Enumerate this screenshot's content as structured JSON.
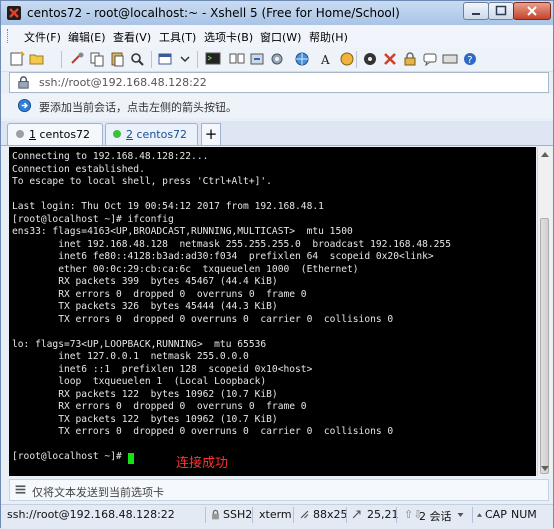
{
  "window": {
    "title": "centos72 - root@localhost:~ - Xshell 5 (Free for Home/School)"
  },
  "menu": {
    "items": [
      "文件(F)",
      "编辑(E)",
      "查看(V)",
      "工具(T)",
      "选项卡(B)",
      "窗口(W)",
      "帮助(H)"
    ]
  },
  "toolbar": {
    "icons": [
      "new-session-icon",
      "open-folder-icon",
      "link-icon",
      "copy-icon",
      "paste-icon",
      "find-icon",
      "properties-icon",
      "terminal-icon",
      "transfer-icon",
      "globe-icon",
      "font-icon",
      "color-icon",
      "keyboard-icon",
      "script-icon",
      "xftp-icon",
      "chat-icon",
      "lock-icon",
      "help-icon"
    ]
  },
  "address": {
    "value": "ssh://root@192.168.48.128:22"
  },
  "info": {
    "text": "要添加当前会话，点击左侧的箭头按钮。"
  },
  "tabs": [
    {
      "num": "1",
      "name": "centos72",
      "active": false,
      "dot_color": "#9aa0a8"
    },
    {
      "num": "2",
      "name": "centos72",
      "active": true,
      "dot_color": "#3cbf3c"
    }
  ],
  "tab_add_label": "+",
  "terminal": {
    "lines": [
      "Connecting to 192.168.48.128:22...",
      "Connection established.",
      "To escape to local shell, press 'Ctrl+Alt+]'.",
      "",
      "Last login: Thu Oct 19 00:54:12 2017 from 192.168.48.1",
      "[root@localhost ~]# ifconfig",
      "ens33: flags=4163<UP,BROADCAST,RUNNING,MULTICAST>  mtu 1500",
      "        inet 192.168.48.128  netmask 255.255.255.0  broadcast 192.168.48.255",
      "        inet6 fe80::4128:b3ad:ad30:f034  prefixlen 64  scopeid 0x20<link>",
      "        ether 00:0c:29:cb:ca:6c  txqueuelen 1000  (Ethernet)",
      "        RX packets 399  bytes 45467 (44.4 KiB)",
      "        RX errors 0  dropped 0  overruns 0  frame 0",
      "        TX packets 326  bytes 45444 (44.3 KiB)",
      "        TX errors 0  dropped 0 overruns 0  carrier 0  collisions 0",
      "",
      "lo: flags=73<UP,LOOPBACK,RUNNING>  mtu 65536",
      "        inet 127.0.0.1  netmask 255.0.0.0",
      "        inet6 ::1  prefixlen 128  scopeid 0x10<host>",
      "        loop  txqueuelen 1  (Local Loopback)",
      "        RX packets 122  bytes 10962 (10.7 KiB)",
      "        RX errors 0  dropped 0  overruns 0  frame 0",
      "        TX packets 122  bytes 10962 (10.7 KiB)",
      "        TX errors 0  dropped 0 overruns 0  carrier 0  collisions 0",
      "",
      "[root@localhost ~]# "
    ],
    "annotation": "连接成功",
    "text_color": "#e6e6e6",
    "cursor_color": "#15e015",
    "annotation_color": "#ff3131"
  },
  "compose": {
    "placeholder": "仅将文本发送到当前选项卡"
  },
  "status": {
    "connection": "ssh://root@192.168.48.128:22",
    "protocol": "SSH2",
    "term": "xterm",
    "size": "88x25",
    "position": "25,21",
    "sessions": "2 会话",
    "cap": "CAP",
    "num": "NUM"
  }
}
